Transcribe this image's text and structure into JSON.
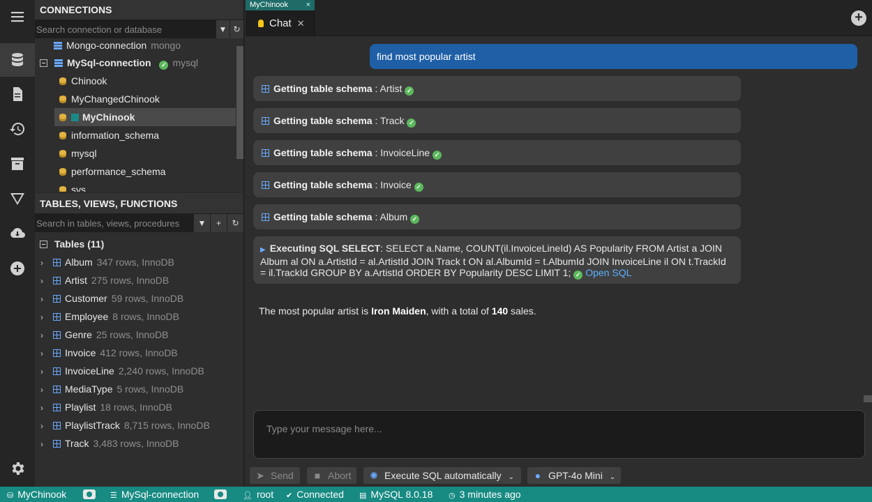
{
  "connections": {
    "header": "CONNECTIONS",
    "search_placeholder": "Search connection or database",
    "items": [
      {
        "label": "Mongo-connection",
        "meta": "mongo"
      },
      {
        "label": "MySql-connection",
        "meta": "mysql"
      }
    ],
    "databases": [
      "Chinook",
      "MyChangedChinook",
      "MyChinook",
      "information_schema",
      "mysql",
      "performance_schema",
      "sys"
    ]
  },
  "tables": {
    "header": "TABLES, VIEWS, FUNCTIONS",
    "search_placeholder": "Search in tables, views, procedures",
    "group_label": "Tables (11)",
    "rows": [
      {
        "name": "Album",
        "meta": "347 rows, InnoDB"
      },
      {
        "name": "Artist",
        "meta": "275 rows, InnoDB"
      },
      {
        "name": "Customer",
        "meta": "59 rows, InnoDB"
      },
      {
        "name": "Employee",
        "meta": "8 rows, InnoDB"
      },
      {
        "name": "Genre",
        "meta": "25 rows, InnoDB"
      },
      {
        "name": "Invoice",
        "meta": "412 rows, InnoDB"
      },
      {
        "name": "InvoiceLine",
        "meta": "2,240 rows, InnoDB"
      },
      {
        "name": "MediaType",
        "meta": "5 rows, InnoDB"
      },
      {
        "name": "Playlist",
        "meta": "18 rows, InnoDB"
      },
      {
        "name": "PlaylistTrack",
        "meta": "8,715 rows, InnoDB"
      },
      {
        "name": "Track",
        "meta": "3,483 rows, InnoDB"
      }
    ]
  },
  "tabs": {
    "mini_label": "MyChinook",
    "chat_label": "Chat"
  },
  "chat": {
    "user_message": "find most popular artist",
    "schema_label": "Getting table schema",
    "schema_steps": [
      "Artist",
      "Track",
      "InvoiceLine",
      "Invoice",
      "Album"
    ],
    "sql_label": "Executing SQL SELECT",
    "sql_text": ": SELECT a.Name, COUNT(il.InvoiceLineId) AS Popularity FROM Artist a JOIN Album al ON a.ArtistId = al.ArtistId JOIN Track t ON al.AlbumId = t.AlbumId JOIN InvoiceLine il ON t.TrackId = il.TrackId GROUP BY a.ArtistId ORDER BY Popularity DESC LIMIT 1;",
    "open_sql": "Open SQL",
    "answer_prefix": "The most popular artist is ",
    "answer_artist": "Iron Maiden",
    "answer_mid": ", with a total of ",
    "answer_count": "140",
    "answer_suffix": " sales.",
    "input_placeholder": "Type your message here..."
  },
  "toolbar": {
    "send": "Send",
    "abort": "Abort",
    "execute": "Execute SQL automatically",
    "model": "GPT-4o Mini"
  },
  "status": {
    "database": "MyChinook",
    "connection": "MySql-connection",
    "user": "root",
    "state": "Connected",
    "server": "MySQL 8.0.18",
    "time": "3 minutes ago"
  },
  "colors": {
    "accent": "#178a82",
    "user_bubble": "#1f5fa6",
    "success": "#5cb85c"
  }
}
